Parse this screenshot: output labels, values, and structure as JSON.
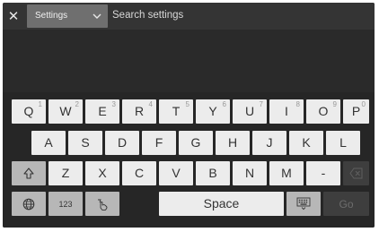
{
  "topbar": {
    "close_icon": "close-icon",
    "dropdown_label": "Settings",
    "search_placeholder": "Search settings"
  },
  "keyboard": {
    "row1": [
      {
        "char": "Q",
        "hint": "1"
      },
      {
        "char": "W",
        "hint": "2"
      },
      {
        "char": "E",
        "hint": "3"
      },
      {
        "char": "R",
        "hint": "4"
      },
      {
        "char": "T",
        "hint": "5"
      },
      {
        "char": "Y",
        "hint": "6"
      },
      {
        "char": "U",
        "hint": "7"
      },
      {
        "char": "I",
        "hint": "8"
      },
      {
        "char": "O",
        "hint": "9"
      },
      {
        "char": "P",
        "hint": "0"
      }
    ],
    "row2": [
      "A",
      "S",
      "D",
      "F",
      "G",
      "H",
      "J",
      "K",
      "L"
    ],
    "row3": [
      "Z",
      "X",
      "C",
      "V",
      "B",
      "N",
      "M",
      "-"
    ],
    "shift_icon": "shift-up-arrow-icon",
    "backspace_icon": "backspace-icon",
    "globe_icon": "globe-icon",
    "numbers_label": "123",
    "handwriting_icon": "handwriting-icon",
    "space_label": "Space",
    "keyboard_icon": "keyboard-icon",
    "go_label": "Go",
    "colors": {
      "key": "#ececec",
      "mod_key": "#b7b7b7",
      "disabled_key": "#3e3e3e",
      "background": "#262626"
    }
  }
}
